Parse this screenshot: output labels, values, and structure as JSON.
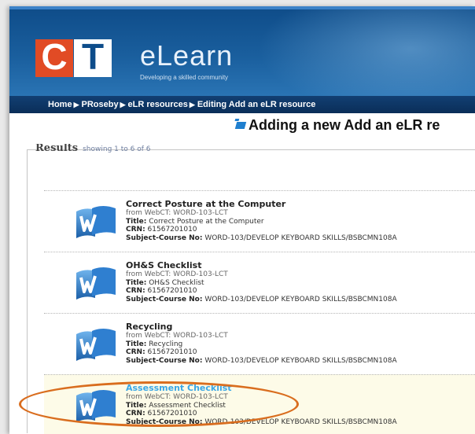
{
  "header": {
    "logo_left": "C",
    "logo_right": "T",
    "brand": "eLearn",
    "tagline": "Developing a skilled community"
  },
  "breadcrumb": [
    "Home",
    "PRoseby",
    "eLR resources",
    "Editing Add an eLR resource"
  ],
  "breadcrumb_separator": "▶",
  "page_title": "Adding a new Add an eLR re",
  "results": {
    "label": "Results",
    "count_text": "showing 1 to 6 of 6",
    "items": [
      {
        "title": "Correct Posture at the Computer",
        "from": "from WebCT: WORD-103-LCT",
        "title_label": "Title:",
        "title_value": "Correct Posture at the Computer",
        "crn_label": "CRN:",
        "crn_value": "61567201010",
        "subject_label": "Subject-Course No:",
        "subject_value": "WORD-103/DEVELOP KEYBOARD SKILLS/BSBCMN108A"
      },
      {
        "title": "OH&S Checklist",
        "from": "from WebCT: WORD-103-LCT",
        "title_label": "Title:",
        "title_value": "OH&S Checklist",
        "crn_label": "CRN:",
        "crn_value": "61567201010",
        "subject_label": "Subject-Course No:",
        "subject_value": "WORD-103/DEVELOP KEYBOARD SKILLS/BSBCMN108A"
      },
      {
        "title": "Recycling",
        "from": "from WebCT: WORD-103-LCT",
        "title_label": "Title:",
        "title_value": "Recycling",
        "crn_label": "CRN:",
        "crn_value": "61567201010",
        "subject_label": "Subject-Course No:",
        "subject_value": "WORD-103/DEVELOP KEYBOARD SKILLS/BSBCMN108A"
      },
      {
        "title": "Assessment Checklist",
        "from": "from WebCT: WORD-103-LCT",
        "title_label": "Title:",
        "title_value": "Assessment Checklist",
        "crn_label": "CRN:",
        "crn_value": "61567201010",
        "subject_label": "Subject-Course No:",
        "subject_value": "WORD-103/DEVELOP KEYBOARD SKILLS/BSBCMN108A"
      }
    ]
  },
  "colors": {
    "banner": "#1a5f9e",
    "breadcrumb_bar": "#0a2e58",
    "logo_orange": "#e14b25",
    "highlight_link": "#3aa7e6",
    "annotation_oval": "#d96d1e"
  },
  "icons": {
    "item_icon": "word-document-icon",
    "title_icon": "resource-flag-icon"
  }
}
